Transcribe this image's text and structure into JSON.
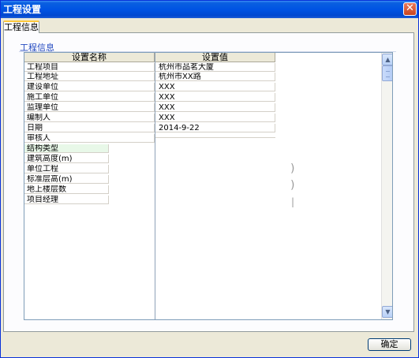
{
  "window": {
    "title": "工程设置"
  },
  "tabs": [
    {
      "label": "工程信息"
    }
  ],
  "group": {
    "label": "工程信息"
  },
  "grid": {
    "columns": [
      "设置名称",
      "设置值"
    ],
    "rows": [
      {
        "name": "工程项目",
        "value": "杭州市品茗大厦"
      },
      {
        "name": "工程地址",
        "value": "杭州市XX路"
      },
      {
        "name": "建设单位",
        "value": "XXX"
      },
      {
        "name": "施工单位",
        "value": "XXX"
      },
      {
        "name": "监理单位",
        "value": "XXX"
      },
      {
        "name": "编制人",
        "value": "XXX"
      },
      {
        "name": "日期",
        "value": "2014-9-22"
      },
      {
        "name": "审核人",
        "value": ""
      },
      {
        "name": "结构类型",
        "value": ""
      },
      {
        "name": "建筑高度(m)",
        "value": ""
      },
      {
        "name": "单位工程",
        "value": ""
      },
      {
        "name": "标准层高(m)",
        "value": ""
      },
      {
        "name": "地上楼层数",
        "value": ""
      },
      {
        "name": "项目经理",
        "value": ""
      }
    ]
  },
  "footer": {
    "ok_label": "确定"
  },
  "icons": {
    "close": "close-icon",
    "scroll_up": "chevron-up-icon",
    "scroll_down": "chevron-down-icon"
  }
}
